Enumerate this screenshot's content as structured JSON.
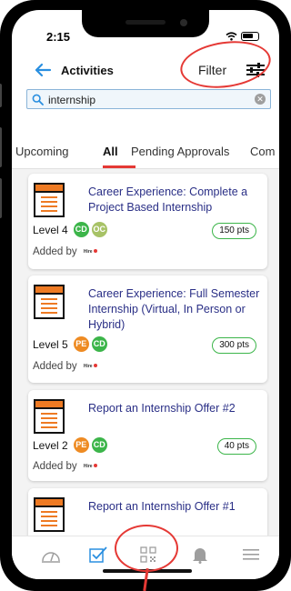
{
  "status": {
    "time": "2:15"
  },
  "header": {
    "title": "Activities",
    "filter_label": "Filter"
  },
  "search": {
    "value": "internship"
  },
  "tabs": [
    {
      "label": "Upcoming"
    },
    {
      "label": "All"
    },
    {
      "label": "Pending Approvals"
    },
    {
      "label": "Com"
    }
  ],
  "cards": [
    {
      "title": "Career Experience: Complete a Project Based Internship",
      "level": "Level 4",
      "badges": [
        "CD",
        "OC"
      ],
      "points": "150 pts",
      "added_by": "Added by",
      "added_logo": "Hire"
    },
    {
      "title": "Career Experience: Full Semester Internship (Virtual, In Person or Hybrid)",
      "level": "Level 5",
      "badges": [
        "PE",
        "CD"
      ],
      "points": "300 pts",
      "added_by": "Added by",
      "added_logo": "Hire"
    },
    {
      "title": "Report an Internship Offer #2",
      "level": "Level 2",
      "badges": [
        "PE",
        "CD"
      ],
      "points": "40 pts",
      "added_by": "Added by",
      "added_logo": "Hire"
    },
    {
      "title": "Report an Internship Offer #1"
    }
  ],
  "nav": [
    {
      "icon": "dashboard-gauge-icon"
    },
    {
      "icon": "checklist-icon"
    },
    {
      "icon": "qr-code-icon"
    },
    {
      "icon": "bell-icon"
    },
    {
      "icon": "menu-icon"
    }
  ],
  "colors": {
    "accent_blue": "#2a8fe0",
    "title_navy": "#2a2f86",
    "tab_underline": "#e53935",
    "badge_cd": "#3cb54a",
    "badge_oc": "#a7c266",
    "badge_pe": "#ee8b23",
    "doc_orange": "#ee7a23",
    "annotation_red": "#e53935"
  }
}
